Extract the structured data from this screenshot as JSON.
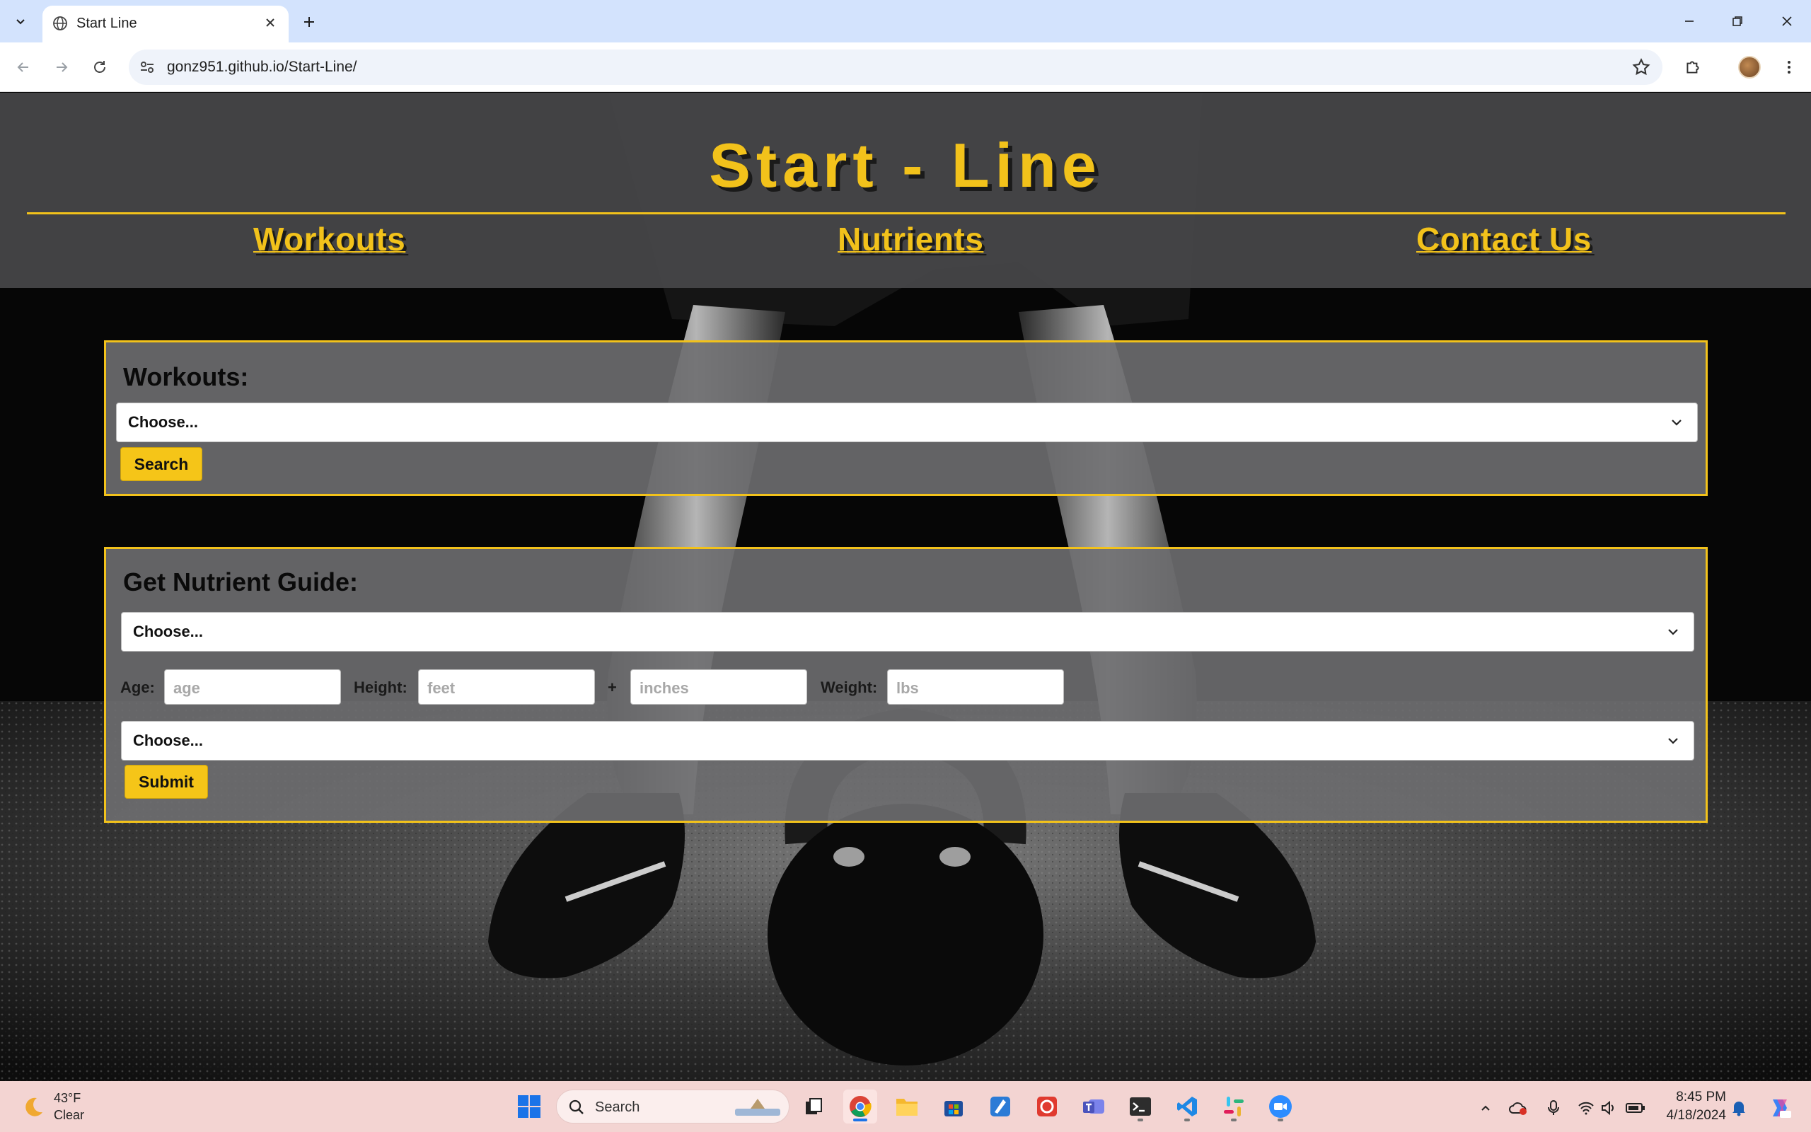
{
  "browser": {
    "tab_title": "Start Line",
    "url": "gonz951.github.io/Start-Line/"
  },
  "site": {
    "title": "Start - Line",
    "nav": [
      "Workouts",
      "Nutrients",
      "Contact Us"
    ]
  },
  "workouts_panel": {
    "heading": "Workouts:",
    "select_value": "Choose...",
    "button_label": "Search"
  },
  "nutrient_panel": {
    "heading": "Get Nutrient Guide:",
    "select1_value": "Choose...",
    "age_label": "Age:",
    "age_placeholder": "age",
    "height_label": "Height:",
    "feet_placeholder": "feet",
    "plus": "+",
    "inches_placeholder": "inches",
    "weight_label": "Weight:",
    "weight_placeholder": "lbs",
    "select2_value": "Choose...",
    "button_label": "Submit"
  },
  "taskbar": {
    "temperature": "43°F",
    "condition": "Clear",
    "search_label": "Search",
    "time": "8:45 PM",
    "date": "4/18/2024"
  },
  "colors": {
    "accent": "#f2c21b",
    "header_bg": "#464648",
    "panel_bg": "#6e6e70",
    "taskbar_bg": "#f3d4d2",
    "tabstrip_bg": "#d3e3fd"
  }
}
